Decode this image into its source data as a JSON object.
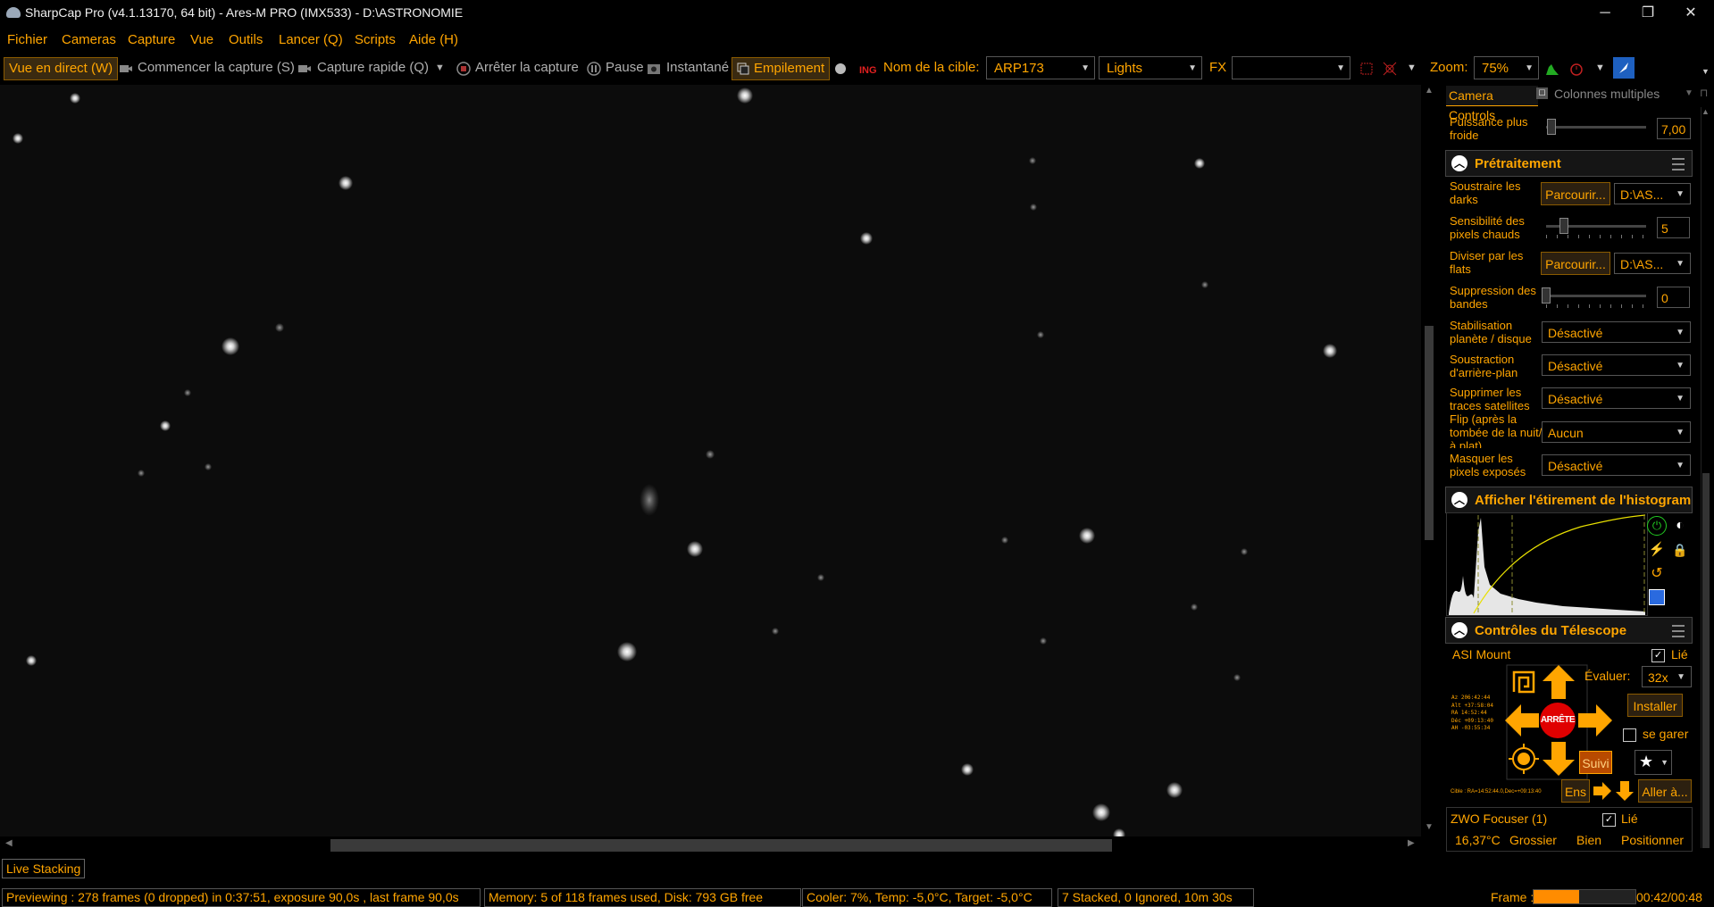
{
  "window": {
    "title": "SharpCap Pro (v4.1.13170, 64 bit) - Ares-M PRO (IMX533) - D:\\ASTRONOMIE",
    "minimize_glyph": "─",
    "maximize_glyph": "❐",
    "close_glyph": "✕"
  },
  "menu": [
    "Fichier",
    "Cameras",
    "Capture",
    "Vue",
    "Outils",
    "Lancer (Q)",
    "Scripts",
    "Aide (H)"
  ],
  "toolbar": {
    "live_view": "Vue en direct (W)",
    "start_capture": "Commencer la capture (S)",
    "quick_capture": "Capture rapide (Q)",
    "stop_capture": "Arrêter la capture",
    "pause": "Pause",
    "snapshot": "Instantané",
    "stacking": "Empilement",
    "target_label": "Nom de la cible:",
    "target_value": "ARP173",
    "frame_type": "Lights",
    "fx_label": "FX",
    "fx_value": "",
    "zoom_label": "Zoom:",
    "zoom_value": "75%"
  },
  "panel": {
    "camera_controls_tab": "Camera Controls",
    "multi_columns": "Colonnes multiples",
    "cooler_power_label": "Puissance plus froide",
    "cooler_power_value": "7,00",
    "preprocessing": {
      "title": "Prétraitement",
      "subtract_darks_label": "Soustraire les darks",
      "browse_button": "Parcourir...",
      "darks_path": "D:\\AS...",
      "hot_pixel_label": "Sensibilité des pixels chauds",
      "hot_pixel_value": "5",
      "divide_flats_label": "Diviser par les flats",
      "flats_path": "D:\\AS...",
      "banding_label": "Suppression des bandes",
      "banding_value": "0",
      "stabilization_label": "Stabilisation planète / disque",
      "stabilization_value": "Désactivé",
      "background_label": "Soustraction d'arrière-plan",
      "background_value": "Désactivé",
      "satellite_label": "Supprimer les traces satellites",
      "satellite_value": "Désactivé",
      "flip_label": "Flip (après la tombée de la nuit/à plat)",
      "flip_value": "Aucun",
      "mask_label": "Masquer les pixels exposés",
      "mask_value": "Désactivé"
    },
    "histogram": {
      "title": "Afficher l'étirement de l'histogramme"
    },
    "telescope": {
      "title": "Contrôles du Télescope",
      "mount_name": "ASI Mount",
      "linked_label": "Lié",
      "rate_label": "Évaluer:",
      "rate_value": "32x",
      "install_button": "Installer",
      "stop_button": "ARRÊTE",
      "park_label": "se garer",
      "tracking_button": "Suivi",
      "set_button": "Ens",
      "goto_button": "Aller à...",
      "coords": [
        {
          "k": "Az",
          "v": "206:42:44"
        },
        {
          "k": "Alt",
          "v": "+37:58:04"
        },
        {
          "k": "RA",
          "v": "14:52:44"
        },
        {
          "k": "Déc",
          "v": "+09:13:40"
        },
        {
          "k": "AH",
          "v": "-03:55:34"
        }
      ],
      "target_line": "Cible : RA=14:52:44.0,Dec=+09:13:40"
    },
    "focuser": {
      "name": "ZWO Focuser (1)",
      "linked_label": "Lié",
      "temperature": "16,37°C",
      "coarse": "Grossier",
      "fine": "Bien",
      "position": "Positionner"
    }
  },
  "live_stacking_tab": "Live Stacking",
  "status": {
    "preview": "Previewing : 278 frames (0 dropped) in 0:37:51, exposure 90,0s , last frame 90,0s",
    "memory": "Memory: 5 of 118 frames used, Disk: 793 GB free",
    "cooler": "Cooler: 7%, Temp: -5,0°C, Target: -5,0°C",
    "stacked": "7 Stacked, 0 Ignored, 10m 30s",
    "frame_label": "Frame :",
    "frame_progress": 0.45,
    "frame_time": "00:42/00:48"
  },
  "colors": {
    "accent": "#ffa500",
    "background": "#000000",
    "sky": "#0c0c0c",
    "stop": "#e00000"
  }
}
